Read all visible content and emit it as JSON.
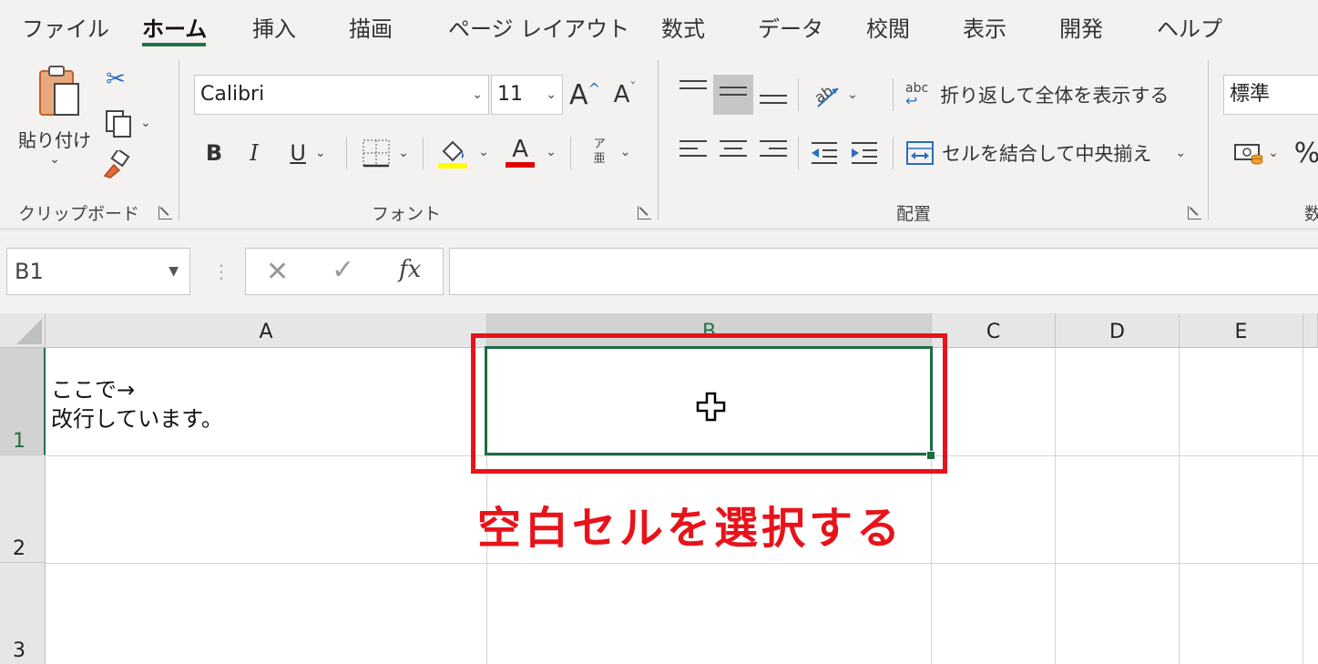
{
  "ribbon": {
    "tabs": [
      {
        "label": "ファイル",
        "active": false
      },
      {
        "label": "ホーム",
        "active": true
      },
      {
        "label": "挿入",
        "active": false
      },
      {
        "label": "描画",
        "active": false
      },
      {
        "label": "ページ レイアウト",
        "active": false
      },
      {
        "label": "数式",
        "active": false
      },
      {
        "label": "データ",
        "active": false
      },
      {
        "label": "校閲",
        "active": false
      },
      {
        "label": "表示",
        "active": false
      },
      {
        "label": "開発",
        "active": false
      },
      {
        "label": "ヘルプ",
        "active": false
      }
    ],
    "clipboard": {
      "paste_label": "貼り付け",
      "group_label": "クリップボード"
    },
    "font": {
      "font_name": "Calibri",
      "font_size": "11",
      "grow_label": "A",
      "shrink_label": "A",
      "bold_label": "B",
      "italic_label": "I",
      "underline_label": "U",
      "font_color_label": "A",
      "phonetic_top": "ア",
      "phonetic_bottom": "亜",
      "group_label": "フォント",
      "highlight_color": "#ffff00",
      "font_color": "#e00000"
    },
    "alignment": {
      "wrap_text_label": "折り返して全体を表示する",
      "merge_center_label": "セルを結合して中央揃え",
      "group_label": "配置",
      "wrap_icon_text": "abc"
    },
    "number": {
      "format_value": "標準",
      "group_label_partial": "数",
      "percent_label": "%"
    }
  },
  "formula_bar": {
    "name_box": "B1",
    "fx_label": "fx",
    "formula": ""
  },
  "grid": {
    "columns": [
      "A",
      "B",
      "C",
      "D",
      "E"
    ],
    "rows": [
      "1",
      "2",
      "3"
    ],
    "selected_column": "B",
    "selected_row": "1",
    "cells": {
      "A1": "ここで→\n改行しています。"
    }
  },
  "annotation": {
    "text": "空白セルを選択する",
    "color": "#e8131a"
  },
  "colors": {
    "accent": "#217346"
  }
}
